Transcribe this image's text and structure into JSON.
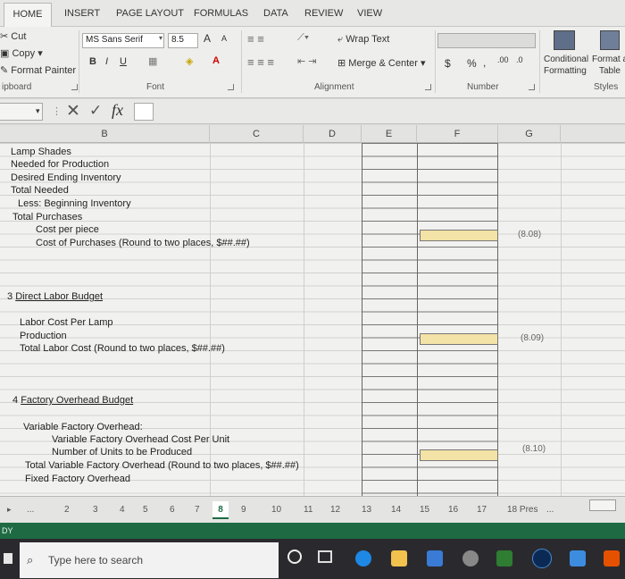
{
  "ribbon": {
    "tabs": [
      "HOME",
      "INSERT",
      "PAGE LAYOUT",
      "FORMULAS",
      "DATA",
      "REVIEW",
      "VIEW"
    ],
    "clipboard": {
      "cut": "Cut",
      "copy": "Copy",
      "format_painter": "Format Painter",
      "group": "ipboard"
    },
    "font": {
      "name": "MS Sans Serif",
      "size": "8.5",
      "bold": "B",
      "italic": "I",
      "underline": "U",
      "group": "Font",
      "grow": "A",
      "shrink": "A"
    },
    "alignment": {
      "wrap_text": "Wrap Text",
      "merge_center": "Merge & Center",
      "group": "Alignment"
    },
    "number": {
      "currency": "$",
      "percent": "%",
      "comma": ",",
      "group": "Number",
      "inc_dec": ".00",
      "dec_dec": ".0"
    },
    "styles": {
      "conditional_1": "Conditional",
      "conditional_2": "Formatting",
      "format_1": "Format a",
      "format_2": "Table",
      "group": "Styles"
    }
  },
  "formula_bar": {
    "fx": "fx"
  },
  "columns": [
    "B",
    "C",
    "D",
    "E",
    "F",
    "G"
  ],
  "rows": {
    "r1": "Lamp Shades",
    "r2": "Needed for Production",
    "r3": "Desired Ending Inventory",
    "r4": "Total Needed",
    "r5": "Less: Beginning Inventory",
    "r6": "Total Purchases",
    "r7": "Cost per piece",
    "r8": "Cost of Purchases (Round to two places, $##.##)",
    "s3_title_num": "3",
    "s3_title": "Direct Labor Budget",
    "l1": "Labor Cost Per Lamp",
    "l2": "Production",
    "l3": "Total Labor Cost  (Round to two places, $##.##)",
    "s4_title_num": "4",
    "s4_title": "Factory Overhead Budget",
    "o1": "Variable Factory Overhead:",
    "o2": "Variable Factory Overhead Cost Per Unit",
    "o3": "Number of Units to be Produced",
    "o4": "Total Variable Factory Overhead  (Round to two places, $##.##)",
    "o5": "Fixed Factory Overhead"
  },
  "values": {
    "v1": "(8.08)",
    "v2": "(8.09)",
    "v3": "(8.10)"
  },
  "sheet_tabs": [
    "...",
    "2",
    "3",
    "4",
    "5",
    "6",
    "7",
    "8",
    "9",
    "10",
    "11",
    "12",
    "13",
    "14",
    "15",
    "16",
    "17",
    "18 Pres",
    "..."
  ],
  "status": "DY",
  "taskbar": {
    "search_placeholder": "Type here to search"
  }
}
